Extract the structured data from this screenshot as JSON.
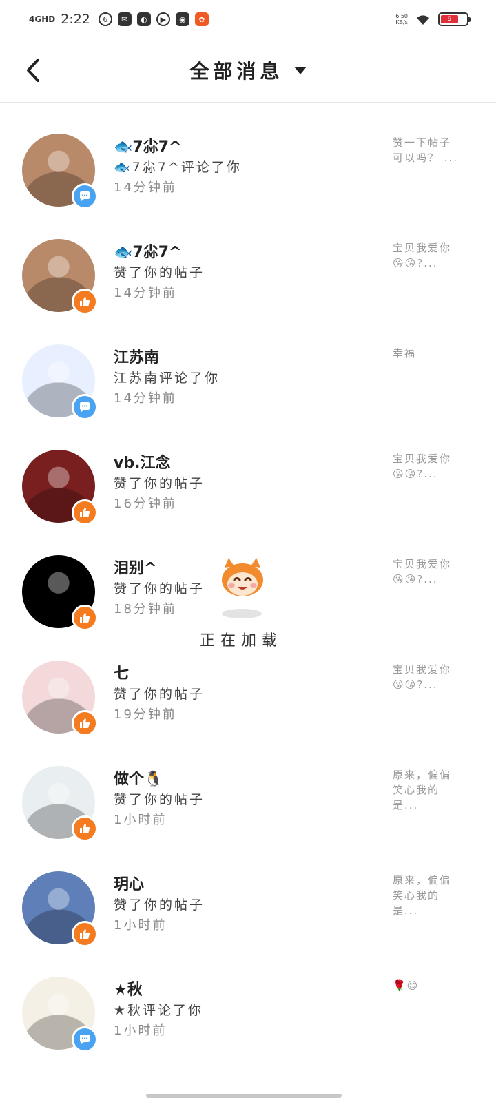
{
  "status_bar": {
    "network": "4GHD",
    "time": "2:22",
    "speed": "6.50\nKB/s",
    "battery": "9"
  },
  "header": {
    "title": "全部消息"
  },
  "notifications": [
    {
      "name": "🐟7尛7^",
      "action": "🐟7尛7^评论了你",
      "time": "14分钟前",
      "preview": "赞一下帖子 可以吗？ ...",
      "type": "comment",
      "avatar_color": "#b98a6a"
    },
    {
      "name": "🐟7尛7^",
      "action": "赞了你的帖子",
      "time": "14分钟前",
      "preview": "宝贝我爱你 😘😘?...",
      "type": "like",
      "avatar_color": "#b98a6a"
    },
    {
      "name": "江苏南",
      "action": "江苏南评论了你",
      "time": "14分钟前",
      "preview": "幸福",
      "type": "comment",
      "avatar_color": "#e8f0ff"
    },
    {
      "name": "vb.江念",
      "action": "赞了你的帖子",
      "time": "16分钟前",
      "preview": "宝贝我爱你 😘😘?...",
      "type": "like",
      "avatar_color": "#7a1f1f"
    },
    {
      "name": "泪别^",
      "action": "赞了你的帖子",
      "time": "18分钟前",
      "preview": "宝贝我爱你 😘😘?...",
      "type": "like",
      "avatar_color": "#000000"
    },
    {
      "name": "七",
      "action": "赞了你的帖子",
      "time": "19分钟前",
      "preview": "宝贝我爱你 😘😘?...",
      "type": "like",
      "avatar_color": "#f3d9d9"
    },
    {
      "name": "做个🐧",
      "action": "赞了你的帖子",
      "time": "1小时前",
      "preview": "原来，偏偏 笑心我的 是...",
      "type": "like",
      "avatar_color": "#e9eef0"
    },
    {
      "name": "玥心",
      "action": "赞了你的帖子",
      "time": "1小时前",
      "preview": "原来，偏偏 笑心我的 是...",
      "type": "like",
      "avatar_color": "#5f7fb8"
    },
    {
      "name": "★秋",
      "action": "★秋评论了你",
      "time": "1小时前",
      "preview": "🌹😊",
      "type": "comment",
      "avatar_color": "#f5f0e6"
    }
  ],
  "loading": {
    "text": "正在加载"
  },
  "icons": {
    "back": "chevron-left-icon",
    "dropdown": "caret-down-icon",
    "comment_badge": "comment-bubble-icon",
    "like_badge": "thumbs-up-icon"
  },
  "colors": {
    "comment_badge": "#4aa3f0",
    "like_badge": "#f47b20",
    "battery": "#e0303a"
  }
}
